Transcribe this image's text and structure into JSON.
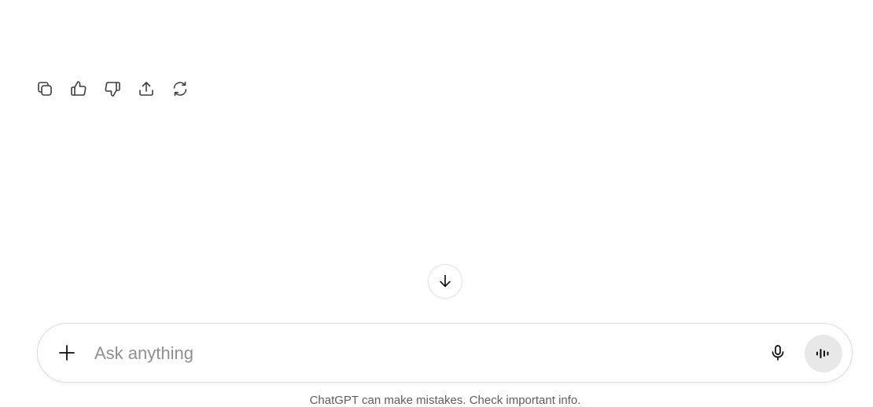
{
  "message_actions": [
    {
      "name": "copy",
      "icon": "copy-icon"
    },
    {
      "name": "good-response",
      "icon": "thumbs-up-icon"
    },
    {
      "name": "bad-response",
      "icon": "thumbs-down-icon"
    },
    {
      "name": "share",
      "icon": "share-icon"
    },
    {
      "name": "regenerate",
      "icon": "regenerate-icon"
    }
  ],
  "scroll_down": {
    "icon": "arrow-down-icon"
  },
  "composer": {
    "placeholder": "Ask anything",
    "value": "",
    "add_icon": "plus-icon",
    "dictate_icon": "microphone-icon",
    "voice_mode_icon": "voice-waveform-icon",
    "voice_button_bg": "#e8e8e8"
  },
  "footer": {
    "disclaimer": "ChatGPT can make mistakes. Check important info."
  }
}
